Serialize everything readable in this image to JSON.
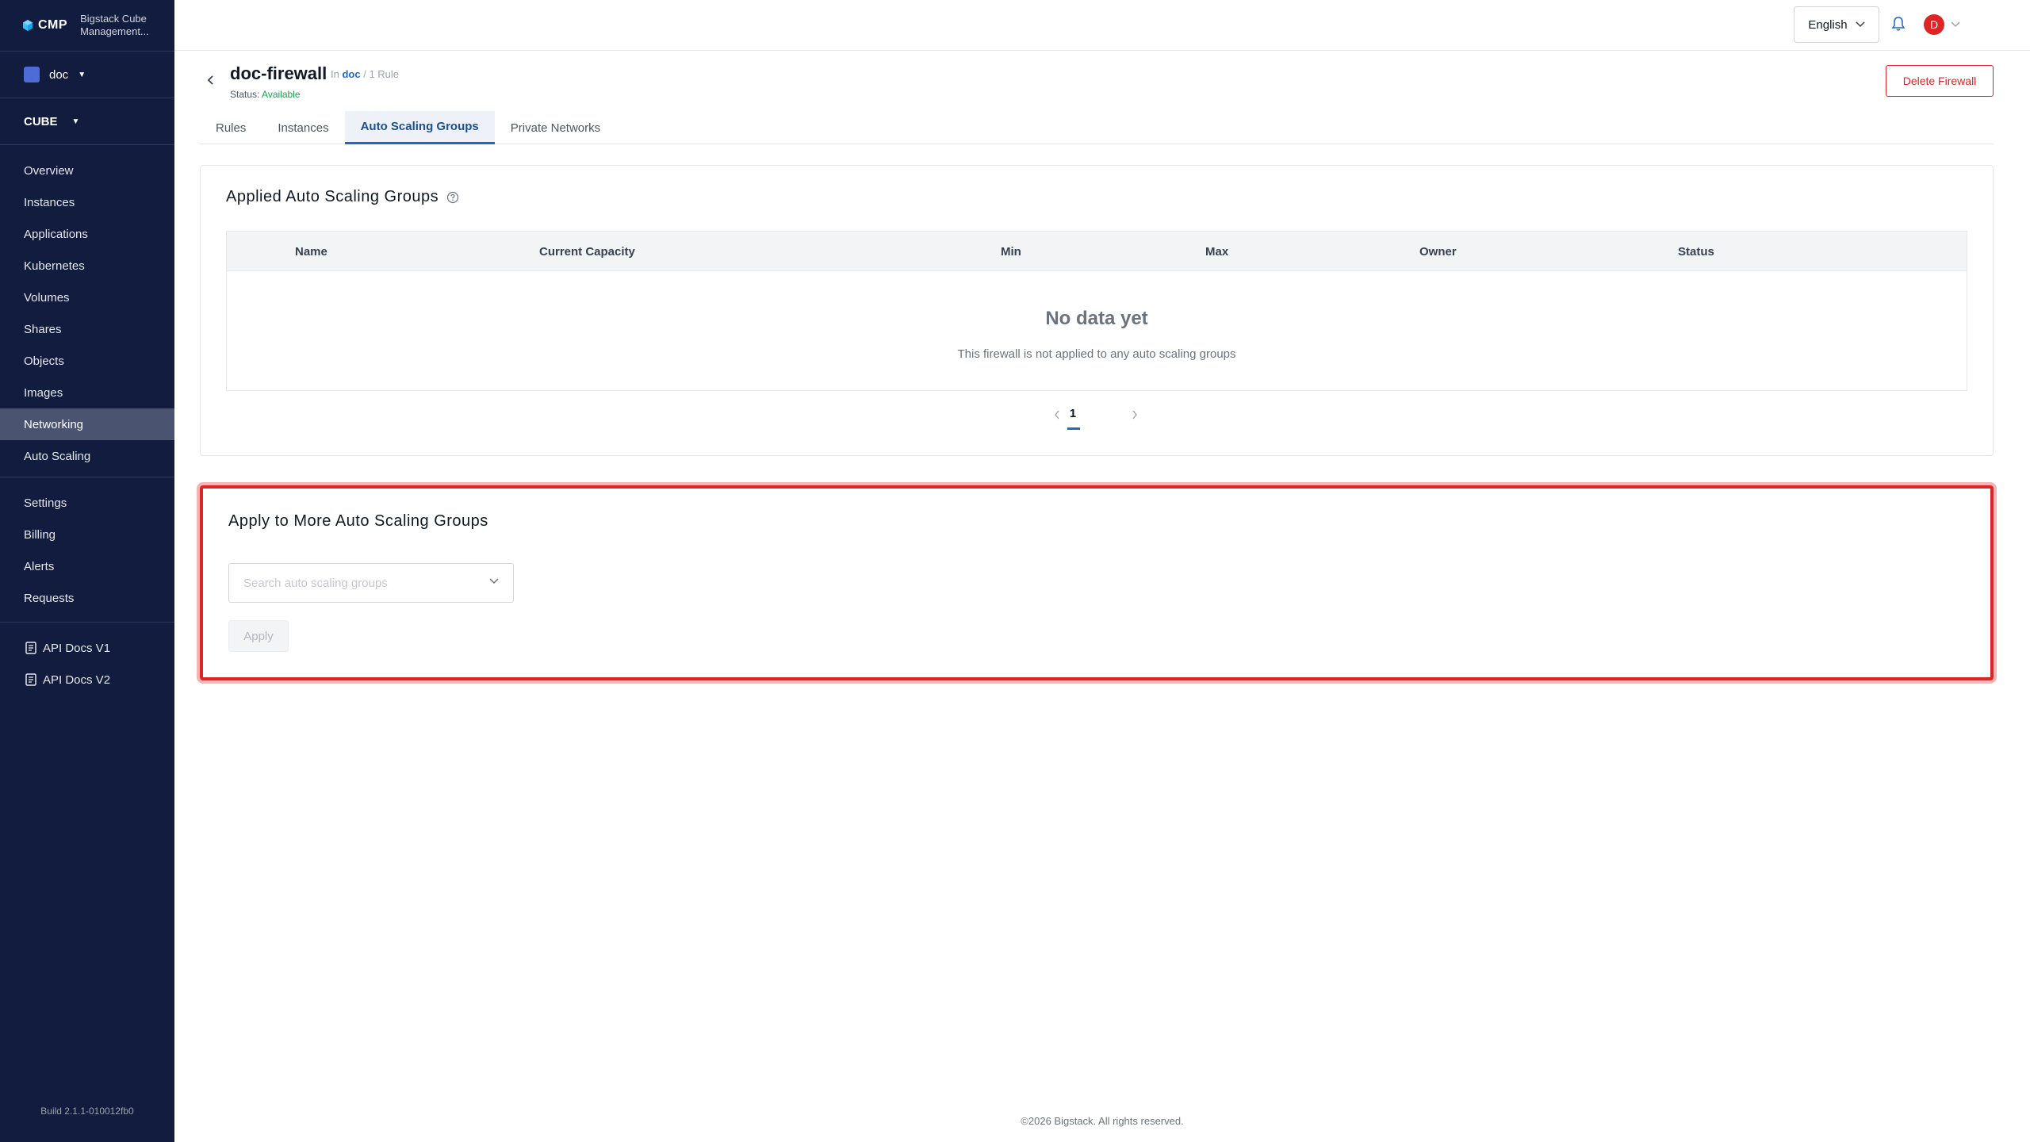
{
  "sidebar": {
    "brand": "CMP",
    "brand_subtitle": "Bigstack Cube Management...",
    "project": "doc",
    "cluster": "CUBE",
    "nav_items": [
      {
        "label": "Overview"
      },
      {
        "label": "Instances"
      },
      {
        "label": "Applications"
      },
      {
        "label": "Kubernetes"
      },
      {
        "label": "Volumes"
      },
      {
        "label": "Shares"
      },
      {
        "label": "Objects"
      },
      {
        "label": "Images"
      },
      {
        "label": "Networking",
        "active": true
      },
      {
        "label": "Auto Scaling"
      }
    ],
    "secondary_items": [
      {
        "label": "Settings"
      },
      {
        "label": "Billing"
      },
      {
        "label": "Alerts"
      },
      {
        "label": "Requests"
      }
    ],
    "doc_links": [
      {
        "label": "API Docs V1"
      },
      {
        "label": "API Docs V2"
      }
    ],
    "build": "Build 2.1.1-010012fb0"
  },
  "topbar": {
    "language": "English",
    "avatar_initial": "D"
  },
  "header": {
    "title": "doc-firewall",
    "in_label": "In",
    "project_link": "doc",
    "rules_count": "/ 1 Rule",
    "status_label": "Status:",
    "status_value": "Available",
    "delete_button": "Delete Firewall"
  },
  "tabs": [
    {
      "label": "Rules"
    },
    {
      "label": "Instances"
    },
    {
      "label": "Auto Scaling Groups",
      "active": true
    },
    {
      "label": "Private Networks"
    }
  ],
  "applied_section": {
    "title": "Applied Auto Scaling Groups",
    "columns": [
      "Name",
      "Current Capacity",
      "Min",
      "Max",
      "Owner",
      "Status"
    ],
    "empty_title": "No data yet",
    "empty_message": "This firewall is not applied to any auto scaling groups",
    "current_page": "1"
  },
  "apply_section": {
    "title": "Apply to More Auto Scaling Groups",
    "search_placeholder": "Search auto scaling groups",
    "apply_button": "Apply"
  },
  "footer": "©2026 Bigstack. All rights reserved.",
  "colors": {
    "sidebar_bg": "#111c3e",
    "accent": "#1d6bc4",
    "danger": "#dc2626",
    "success": "#16a34a",
    "highlight": "#e02424"
  }
}
